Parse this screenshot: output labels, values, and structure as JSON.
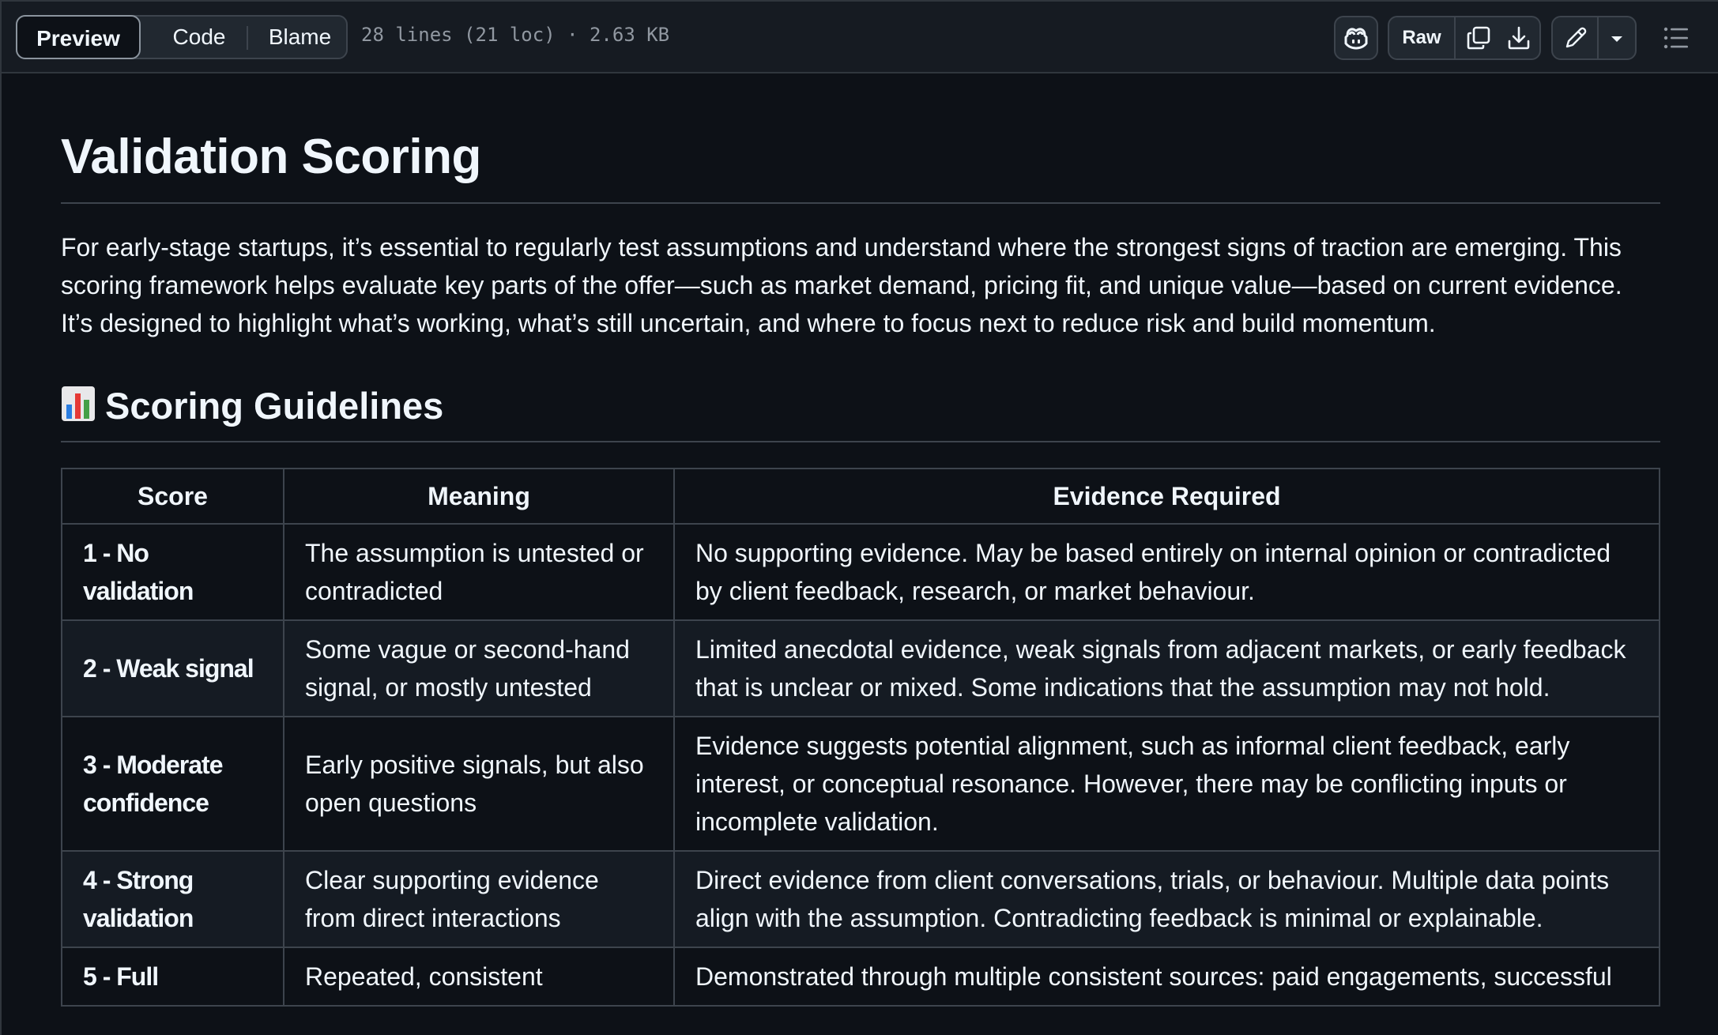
{
  "toolbar": {
    "tabs": {
      "preview": "Preview",
      "code": "Code",
      "blame": "Blame"
    },
    "file_meta": "28 lines (21 loc) · 2.63 KB",
    "raw_label": "Raw",
    "icons": {
      "copilot": "copilot-icon",
      "copy": "copy-icon",
      "download": "download-icon",
      "edit": "pencil-icon",
      "more": "triangle-down-icon",
      "outline": "list-unordered-icon"
    }
  },
  "document": {
    "title": "Validation Scoring",
    "intro": "For early-stage startups, it’s essential to regularly test assumptions and understand where the strongest signs of traction are emerging. This scoring framework helps evaluate key parts of the offer—such as market demand, pricing fit, and unique value—based on current evidence. It’s designed to highlight what’s working, what’s still uncertain, and where to focus next to reduce risk and build momentum.",
    "section_heading": "Scoring Guidelines",
    "section_icon": "bar-chart-emoji",
    "table": {
      "headers": [
        "Score",
        "Meaning",
        "Evidence Required"
      ],
      "rows": [
        {
          "score": "1 - No validation",
          "meaning": "The assumption is untested or contradicted",
          "evidence": "No supporting evidence. May be based entirely on internal opinion or contradicted by client feedback, research, or market behaviour."
        },
        {
          "score": "2 - Weak signal",
          "meaning": "Some vague or second-hand signal, or mostly untested",
          "evidence": "Limited anecdotal evidence, weak signals from adjacent markets, or early feedback that is unclear or mixed. Some indications that the assumption may not hold."
        },
        {
          "score": "3 - Moderate confidence",
          "meaning": "Early positive signals, but also open questions",
          "evidence": "Evidence suggests potential alignment, such as informal client feedback, early interest, or conceptual resonance. However, there may be conflicting inputs or incomplete validation."
        },
        {
          "score": "4 - Strong validation",
          "meaning": "Clear supporting evidence from direct interactions",
          "evidence": "Direct evidence from client conversations, trials, or behaviour. Multiple data points align with the assumption. Contradicting feedback is minimal or explainable."
        },
        {
          "score": "5 - Full",
          "meaning": "Repeated, consistent",
          "evidence": "Demonstrated through multiple consistent sources: paid engagements, successful"
        }
      ]
    }
  },
  "colors": {
    "background": "#0d1117",
    "toolbar_bg": "#161b22",
    "border": "#3d444d",
    "text": "#f0f6fc",
    "muted_text": "#9198a1"
  }
}
